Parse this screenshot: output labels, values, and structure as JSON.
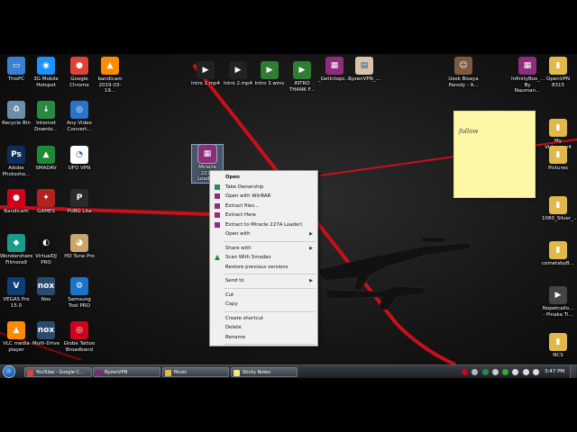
{
  "desktop_icons": [
    {
      "label": "ThisPC",
      "color": "#3a7fd1",
      "sym": "▭"
    },
    {
      "label": "3G Mobile\nHotspot",
      "color": "#1e90ff",
      "sym": "◉"
    },
    {
      "label": "Google\nChrome",
      "color": "#db4437",
      "sym": "●"
    },
    {
      "label": "bandicam\n2019-03-19...",
      "color": "#ff8c00",
      "sym": "▲"
    },
    {
      "label": "Intro 1.mp4",
      "color": "#222",
      "sym": "▶"
    },
    {
      "label": "Intro 2.mp4",
      "color": "#222",
      "sym": "▶"
    },
    {
      "label": "Intro 3.wmv",
      "color": "#2e7d32",
      "sym": "▶"
    },
    {
      "label": "INTRO\nTHANK F...",
      "color": "#2e7d32",
      "sym": "▶"
    },
    {
      "label": "_Getintopc....",
      "color": "#8e2d7e",
      "sym": "▦"
    },
    {
      "label": "RyzenVPN_...",
      "color": "#d9c2a6",
      "sym": "▤"
    },
    {
      "label": "Usok Bisaya\nParody - A...",
      "color": "#7b5a40",
      "sym": "☺"
    },
    {
      "label": "InfinityBox_...\nBy Nauman...",
      "color": "#8e2d7e",
      "sym": "▦"
    },
    {
      "label": "OpenVPN\n8315",
      "color": "#e0b94a",
      "sym": "▮"
    },
    {
      "label": "Recycle Bin",
      "color": "#6b8fa8",
      "sym": "♻"
    },
    {
      "label": "Internet\nDownlo...",
      "color": "#2c8a3f",
      "sym": "↓"
    },
    {
      "label": "Any Video\nConvert...",
      "color": "#2a74c9",
      "sym": "◎"
    },
    {
      "label": "My\nVideo.mp4",
      "color": "#e0b94a",
      "sym": "▮"
    },
    {
      "label": "Adobe\nPhotosho...",
      "color": "#0b2f5a",
      "sym": "Ps"
    },
    {
      "label": "SMADAV",
      "color": "#1f8a36",
      "sym": "▲"
    },
    {
      "label": "UFO VPN",
      "color": "#ffffff",
      "sym": "◔"
    },
    {
      "label": "Pictures",
      "color": "#e0b94a",
      "sym": "▮"
    },
    {
      "label": "Bandicam",
      "color": "#d0021b",
      "sym": "●"
    },
    {
      "label": "GAMES",
      "color": "#b0231f",
      "sym": "✦"
    },
    {
      "label": "PUBG Lite",
      "color": "#2b2b2b",
      "sym": "P"
    },
    {
      "label": "1080_Silver_...",
      "color": "#e0b94a",
      "sym": "▮"
    },
    {
      "label": "Wondershare\nFilmora9",
      "color": "#1a9c8a",
      "sym": "◆"
    },
    {
      "label": "VirtualDJ\nPRO",
      "color": "#111",
      "sym": "◐"
    },
    {
      "label": "HD Tune Pro",
      "color": "#caa46b",
      "sym": "◕"
    },
    {
      "label": "cometsbyB...",
      "color": "#e0b94a",
      "sym": "▮"
    },
    {
      "label": "VEGAS Pro\n15.0",
      "color": "#0c3f75",
      "sym": "V"
    },
    {
      "label": "Nox",
      "color": "#2b4a6f",
      "sym": "nox"
    },
    {
      "label": "Samsung\nTool PRO",
      "color": "#1b74c9",
      "sym": "⚙"
    },
    {
      "label": "Nopetcallo...\n- Pinaka Ti...",
      "color": "#444",
      "sym": "▶"
    },
    {
      "label": "VLC media\nplayer",
      "color": "#ff8c00",
      "sym": "▲"
    },
    {
      "label": "Multi-Drive",
      "color": "#2b4a6f",
      "sym": "nox"
    },
    {
      "label": "Globe Tattoo\nBroadband",
      "color": "#d0021b",
      "sym": "◎"
    },
    {
      "label": "NCS",
      "color": "#e0b94a",
      "sym": "▮"
    },
    {
      "label": "Miracle\n227A Loade...",
      "color": "#8e2d7e",
      "sym": "▦"
    }
  ],
  "sticky_note": {
    "text": "follow"
  },
  "context_menu": [
    {
      "label": "Open",
      "bold": true,
      "icon": "",
      "arrow": false
    },
    {
      "label": "Take Ownership",
      "icon": "green-shield",
      "arrow": false
    },
    {
      "label": "Open with WinRAR",
      "icon": "winrar",
      "arrow": false
    },
    {
      "label": "Extract files...",
      "icon": "winrar",
      "arrow": false
    },
    {
      "label": "Extract Here",
      "icon": "winrar",
      "arrow": false
    },
    {
      "label": "Extract to Miracle 227A Loader\\",
      "icon": "winrar",
      "arrow": false
    },
    {
      "label": "Open with",
      "icon": "",
      "arrow": true
    },
    {
      "sep": true
    },
    {
      "label": "Share with",
      "icon": "",
      "arrow": true
    },
    {
      "label": "Scan With Smadav",
      "icon": "smadav",
      "arrow": false
    },
    {
      "label": "Restore previous versions",
      "icon": "",
      "arrow": false
    },
    {
      "sep": true
    },
    {
      "label": "Send to",
      "icon": "",
      "arrow": true
    },
    {
      "sep": true
    },
    {
      "label": "Cut",
      "icon": "",
      "arrow": false
    },
    {
      "label": "Copy",
      "icon": "",
      "arrow": false
    },
    {
      "sep": true
    },
    {
      "label": "Create shortcut",
      "icon": "",
      "arrow": false
    },
    {
      "label": "Delete",
      "icon": "",
      "arrow": false
    },
    {
      "label": "Rename",
      "icon": "",
      "arrow": false
    },
    {
      "sep": true
    },
    {
      "label": "Properties",
      "icon": "",
      "arrow": false
    }
  ],
  "taskbar": {
    "start_label": "Start",
    "tasks": [
      {
        "label": "YouTube - Google C...",
        "color": "#db4437"
      },
      {
        "label": "RyzenVPN",
        "color": "#7a2a7a"
      },
      {
        "label": "Music",
        "color": "#e0b94a"
      },
      {
        "label": "Sticky Notes",
        "color": "#f3e679"
      }
    ],
    "clock": "3:47 PM",
    "tray_colors": [
      "#d0021b",
      "#bbbbbb",
      "#2c8a3f",
      "#cccccc",
      "#33aa33",
      "#dddddd",
      "#dddddd",
      "#dddddd"
    ]
  },
  "colors": {
    "stripe": "#c8101a",
    "menu_bg": "#f0f0f0",
    "taskbar": "#2a2e34",
    "sticky": "#fcf8a6"
  }
}
